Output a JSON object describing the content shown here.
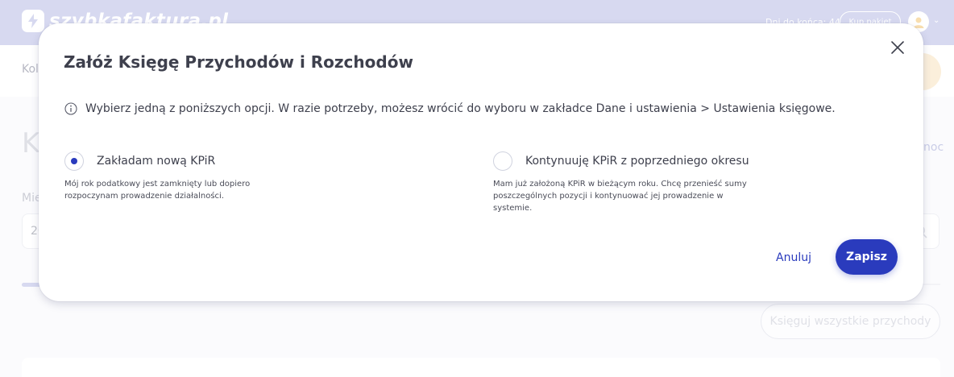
{
  "app": {
    "logo_text": "szybkafaktura.pl",
    "trial_text": "Dni do końca: 44",
    "buy_label": "Kup pakiet"
  },
  "background": {
    "breadcrumb": "Kol",
    "help_partial": "e",
    "page_title_partial": "K",
    "help_link_partial": "noc",
    "field_label_partial": "Mie",
    "field_value_partial": "20",
    "book_all_label": "Księguj wszystkie przychody"
  },
  "modal": {
    "title": "Załóż Księgę Przychodów i Rozchodów",
    "info": "Wybierz jedną z poniższych opcji. W razie potrzeby, możesz wrócić do wyboru w zakładce Dane i ustawienia > Ustawienia księgowe.",
    "options": [
      {
        "label": "Zakładam nową KPiR",
        "description": "Mój rok podatkowy jest zamknięty lub dopiero rozpoczynam prowadzenie działalności.",
        "checked": true
      },
      {
        "label": "Kontynuuję KPiR z poprzedniego okresu",
        "description": "Mam już założoną KPiR w bieżącym roku. Chcę przenieść sumy poszczególnych pozycji i kontynuować jej prowadzenie w systemie.",
        "checked": false
      }
    ],
    "cancel_label": "Anuluj",
    "save_label": "Zapisz"
  },
  "colors": {
    "topbar": "#b6bbe4",
    "primary": "#2a3bbd",
    "text": "#3e404d"
  },
  "icons": {
    "logo": "lightning-bolt-icon",
    "info": "info-circle-icon",
    "close": "close-icon",
    "avatar": "user-avatar-icon",
    "chevron": "chevron-down-icon",
    "search": "search-icon"
  }
}
